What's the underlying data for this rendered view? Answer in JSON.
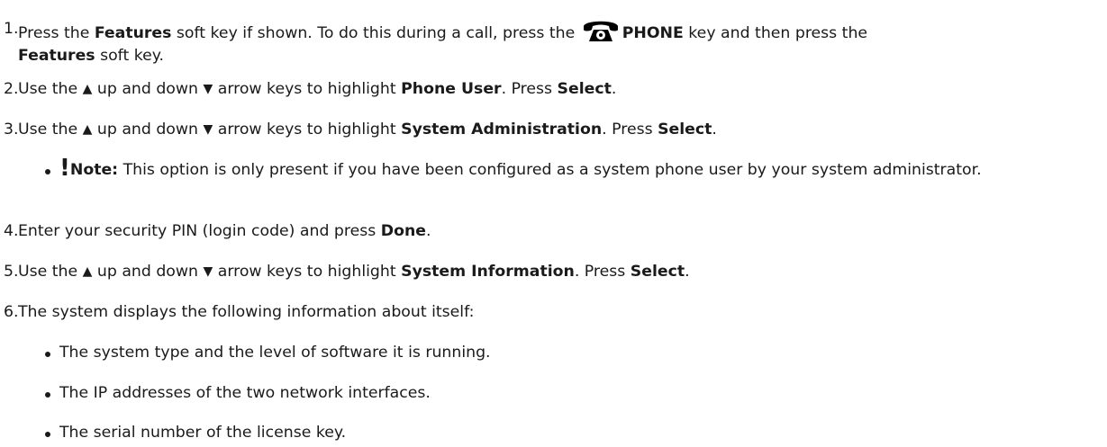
{
  "steps": [
    {
      "num": "1.",
      "parts": {
        "a": "Press the ",
        "b": "Features",
        "c": " soft key if shown. To do this during a call, press the ",
        "d": "PHONE",
        "e": " key and then press the",
        "f": "Features",
        "g": " soft key."
      }
    },
    {
      "num": "2.",
      "parts": {
        "a": "Use the ",
        "b": " up and down ",
        "c": " arrow keys to highlight ",
        "d": "Phone User",
        "e": ". Press ",
        "f": "Select",
        "g": "."
      }
    },
    {
      "num": "3.",
      "parts": {
        "a": "Use the ",
        "b": " up and down ",
        "c": " arrow keys to highlight ",
        "d": "System Administration",
        "e": ". Press ",
        "f": "Select",
        "g": "."
      }
    },
    {
      "num": "4.",
      "parts": {
        "a": "Enter your security PIN (login code) and press ",
        "b": "Done",
        "c": "."
      }
    },
    {
      "num": "5.",
      "parts": {
        "a": "Use the ",
        "b": " up and down ",
        "c": " arrow keys to highlight ",
        "d": "System Information",
        "e": ". Press ",
        "f": "Select",
        "g": "."
      }
    },
    {
      "num": "6.",
      "parts": {
        "a": "The system displays the following information about itself:"
      }
    }
  ],
  "note": {
    "mark": "!",
    "label": "Note:",
    "text": " This option is only present if you have been configured as a system phone user by your system administrator."
  },
  "info_items": [
    "The system type and the level of software it is running.",
    "The IP addresses of the two network interfaces.",
    "The serial number of the license key."
  ],
  "glyphs": {
    "up_arrow": "▲",
    "down_arrow": "▼"
  }
}
